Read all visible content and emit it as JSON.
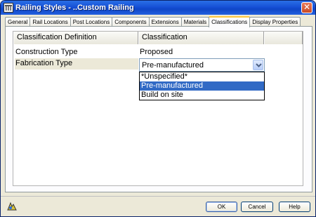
{
  "window": {
    "title": "Railing Styles - ..Custom Railing",
    "close_label": "✕"
  },
  "tabs": [
    {
      "label": "General"
    },
    {
      "label": "Rail Locations"
    },
    {
      "label": "Post Locations"
    },
    {
      "label": "Components"
    },
    {
      "label": "Extensions"
    },
    {
      "label": "Materials"
    },
    {
      "label": "Classifications",
      "active": true
    },
    {
      "label": "Display Properties"
    }
  ],
  "grid": {
    "columns": [
      "Classification Definition",
      "Classification"
    ],
    "rows": [
      {
        "definition": "Construction Type",
        "classification": "Proposed"
      },
      {
        "definition": "Fabrication Type",
        "classification": "Pre-manufactured"
      }
    ]
  },
  "dropdown": {
    "options": [
      "*Unspecified*",
      "Pre-manufactured",
      "Build on site"
    ],
    "selected_index": 1
  },
  "footer": {
    "ok_label": "OK",
    "cancel_label": "Cancel",
    "help_label": "Help"
  },
  "colors": {
    "selection": "#316ac5",
    "title_bar": "#1650d6",
    "active_tab_accent": "#ffc83c"
  }
}
